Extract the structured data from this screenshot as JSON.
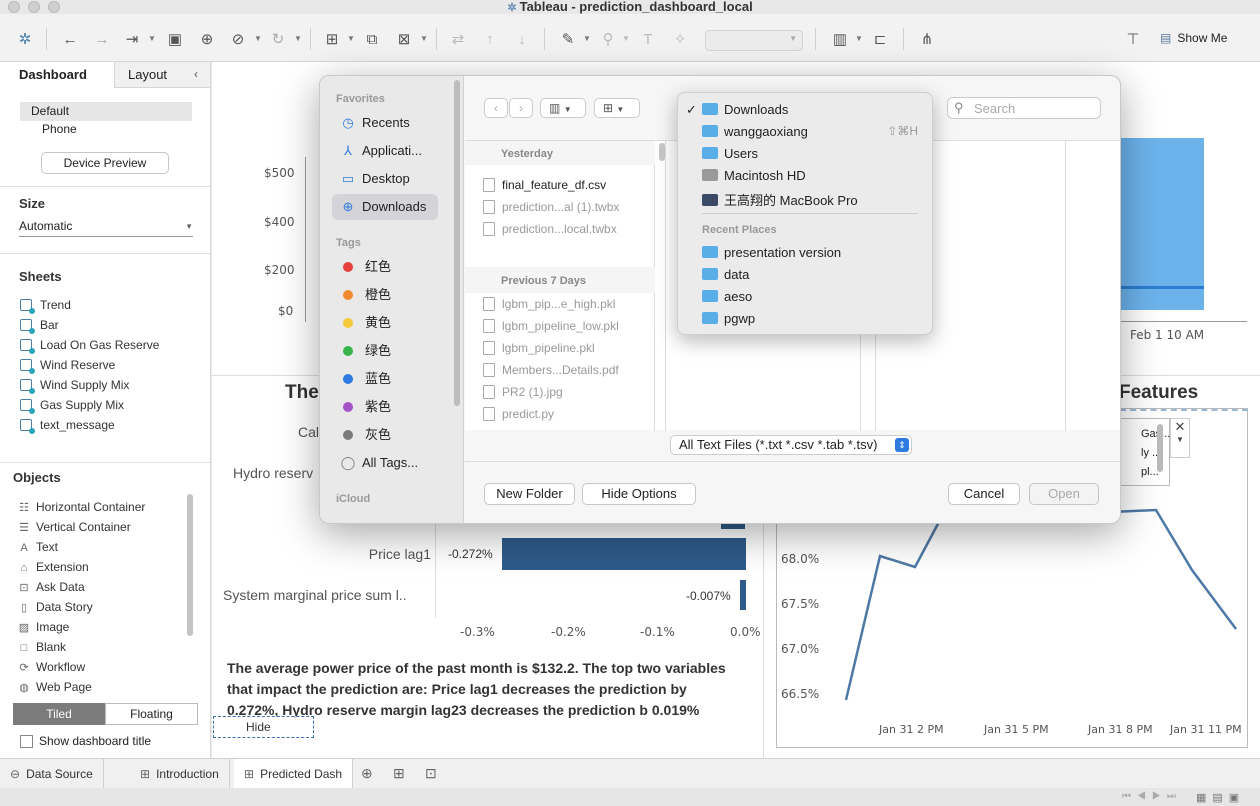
{
  "window": {
    "title": "Tableau - prediction_dashboard_local"
  },
  "toolbar": {
    "show_me": "Show Me"
  },
  "sidebar": {
    "tabs": [
      "Dashboard",
      "Layout"
    ],
    "devices": [
      "Default",
      "Phone"
    ],
    "device_preview": "Device Preview",
    "size_heading": "Size",
    "size_value": "Automatic",
    "sheets_heading": "Sheets",
    "sheets": [
      "Trend",
      "Bar",
      "Load On Gas Reserve",
      "Wind Reserve",
      "Wind Supply Mix",
      "Gas Supply Mix",
      "text_message"
    ],
    "objects_heading": "Objects",
    "objects": [
      "Horizontal Container",
      "Vertical Container",
      "Text",
      "Extension",
      "Ask Data",
      "Data Story",
      "Image",
      "Blank",
      "Workflow",
      "Web Page"
    ],
    "tiled": "Tiled",
    "floating": "Floating",
    "show_title": "Show dashboard title"
  },
  "dashboard": {
    "top_chart_y_ticks": [
      "$500",
      "$400",
      "$200",
      "$0"
    ],
    "top_right_x_tick": "Feb 1 10 AM",
    "left_title_fragment": "The",
    "right_title_fragment": "Features",
    "bar_labels_partial": [
      "Cal",
      "Hydro reserv"
    ],
    "bars": [
      {
        "label": "Price lag1",
        "value_text": "-0.272%",
        "value": -0.272
      },
      {
        "label": "System marginal price sum l..",
        "value_text": "-0.007%",
        "value": -0.007
      }
    ],
    "bar_x_ticks": [
      "-0.3%",
      "-0.2%",
      "-0.1%",
      "0.0%"
    ],
    "message": "The average power price of the past month is $132.2. The top two variables that impact the prediction are: Price lag1 decreases the prediction by 0.272%, Hydro reserve margin lag23 decreases the prediction b 0.019%",
    "hide_label": "Hide",
    "line_y_ticks": [
      "68.0%",
      "67.5%",
      "67.0%",
      "66.5%"
    ],
    "line_x_ticks": [
      "Jan 31 2 PM",
      "Jan 31 5 PM",
      "Jan 31 8 PM",
      "Jan 31 11 PM"
    ],
    "legend_items": [
      "Gas...",
      "ly ...",
      "pl..."
    ]
  },
  "bottom": {
    "tabs": [
      "Data Source",
      "Introduction",
      "Predicted Dash"
    ]
  },
  "dialog": {
    "favorites_heading": "Favorites",
    "favorites": [
      "Recents",
      "Applicati...",
      "Desktop",
      "Downloads"
    ],
    "tags_heading": "Tags",
    "tags": [
      {
        "name": "红色",
        "color": "#e5403a"
      },
      {
        "name": "橙色",
        "color": "#f0892f"
      },
      {
        "name": "黄色",
        "color": "#f4c93a"
      },
      {
        "name": "绿色",
        "color": "#3ab54a"
      },
      {
        "name": "蓝色",
        "color": "#2d7be0"
      },
      {
        "name": "紫色",
        "color": "#a553c8"
      },
      {
        "name": "灰色",
        "color": "#7a7a7a"
      }
    ],
    "all_tags": "All Tags...",
    "icloud": "iCloud",
    "search_placeholder": "Search",
    "group_yesterday": "Yesterday",
    "files_yesterday": [
      "final_feature_df.csv",
      "prediction...al (1).twbx",
      "prediction...local.twbx"
    ],
    "group_prev7": "Previous 7 Days",
    "files_prev7": [
      "lgbm_pip...e_high.pkl",
      "lgbm_pipeline_low.pkl",
      "lgbm_pipeline.pkl",
      "Members...Details.pdf",
      "PR2 (1).jpg",
      "predict.py"
    ],
    "file_type": "All Text Files (*.txt *.csv *.tab *.tsv)",
    "new_folder": "New Folder",
    "hide_options": "Hide Options",
    "cancel": "Cancel",
    "open": "Open"
  },
  "popup": {
    "locations": [
      "Downloads",
      "wanggaoxiang",
      "Users",
      "Macintosh HD",
      "王高翔的 MacBook Pro"
    ],
    "shortcut": "⇧⌘H",
    "recent_heading": "Recent Places",
    "recent": [
      "presentation version",
      "data",
      "aeso",
      "pgwp"
    ]
  }
}
